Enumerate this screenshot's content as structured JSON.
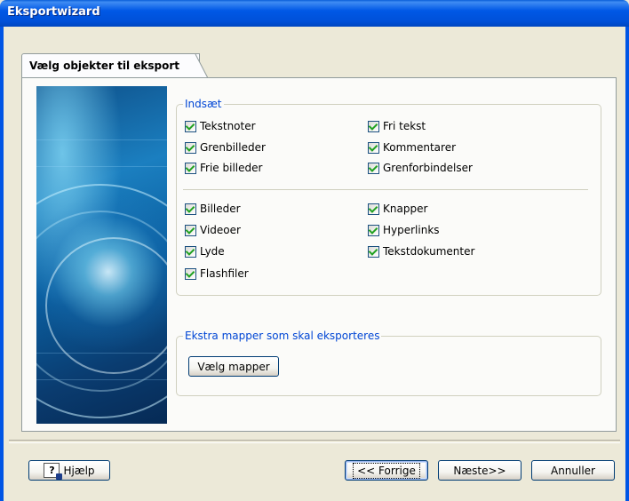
{
  "window": {
    "title": "Eksportwizard"
  },
  "tab": {
    "label": "Vælg objekter til eksport"
  },
  "insert_group": {
    "legend": "Indsæt",
    "col1": [
      {
        "label": "Tekstnoter",
        "checked": true
      },
      {
        "label": "Grenbilleder",
        "checked": true
      },
      {
        "label": "Frie billeder",
        "checked": true
      },
      {
        "label": "Billeder",
        "checked": true
      },
      {
        "label": "Videoer",
        "checked": true
      },
      {
        "label": "Lyde",
        "checked": true
      },
      {
        "label": "Flashfiler",
        "checked": true
      }
    ],
    "col2": [
      {
        "label": "Fri tekst",
        "checked": true
      },
      {
        "label": "Kommentarer",
        "checked": true
      },
      {
        "label": "Grenforbindelser",
        "checked": true
      },
      {
        "label": "Knapper",
        "checked": true
      },
      {
        "label": "Hyperlinks",
        "checked": true
      },
      {
        "label": "Tekstdokumenter",
        "checked": true
      }
    ]
  },
  "extra_group": {
    "legend": "Ekstra mapper som skal eksporteres",
    "button": "Vælg mapper"
  },
  "footer": {
    "help": "Hjælp",
    "back": "<< Forrige",
    "next": "Næste>>",
    "cancel": "Annuller"
  },
  "colors": {
    "titlebar": "#0055e5",
    "legend_text": "#0046d5",
    "check": "#21a121"
  }
}
